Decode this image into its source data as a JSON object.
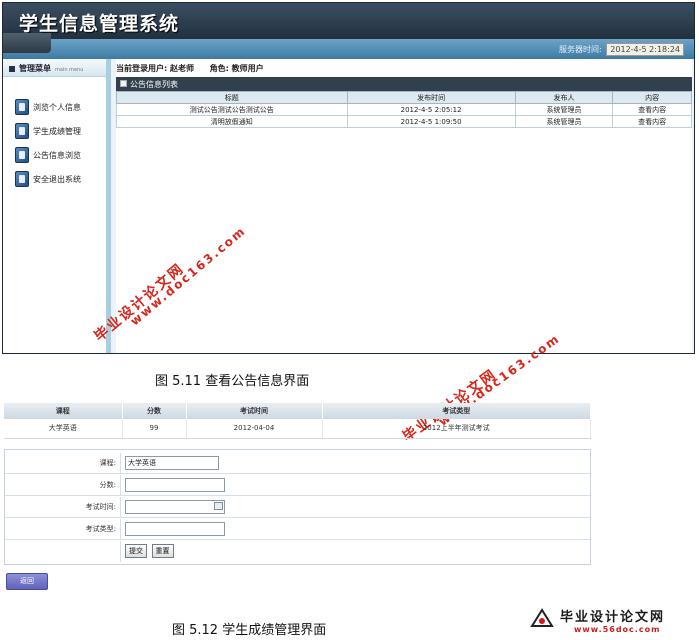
{
  "app": {
    "title": "学生信息管理系统",
    "server_time_label": "服务器时间:",
    "server_time_value": "2012-4-5 2:18:24"
  },
  "sidebar": {
    "header": "管理菜单",
    "header_sub": "main menu",
    "items": [
      {
        "label": "浏览个人信息",
        "icon": "document-icon"
      },
      {
        "label": "学生成绩管理",
        "icon": "document-icon"
      },
      {
        "label": "公告信息浏览",
        "icon": "document-icon"
      },
      {
        "label": "安全退出系统",
        "icon": "document-icon"
      }
    ]
  },
  "userbar": {
    "user_label": "当前登录用户:",
    "user_name": "赵老师",
    "role_label": "角色:",
    "role_name": "教师用户"
  },
  "notice_panel": {
    "title": "公告信息列表",
    "columns": [
      "标题",
      "发布时间",
      "发布人",
      "内容"
    ],
    "rows": [
      [
        "测试公告测试公告测试公告",
        "2012-4-5 2:05:12",
        "系统管理员",
        "查看内容"
      ],
      [
        "清明放假通知",
        "2012-4-5 1:09:50",
        "系统管理员",
        "查看内容"
      ]
    ]
  },
  "watermarks": {
    "site": "www.doc163.com",
    "name": "毕业设计论文网"
  },
  "captions": {
    "fig1": "图 5.11 查看公告信息界面",
    "fig2": "图 5.12 学生成绩管理界面"
  },
  "grades_table": {
    "columns": [
      "课程",
      "分数",
      "考试时间",
      "考试类型"
    ],
    "rows": [
      [
        "大学英语",
        "99",
        "2012-04-04",
        "2012上半年测试考试"
      ]
    ]
  },
  "grade_form": {
    "course_label": "课程:",
    "course_value": "大学英语",
    "score_label": "分数:",
    "score_value": "",
    "time_label": "考试时间:",
    "time_value": "",
    "type_label": "考试类型:",
    "type_value": "",
    "submit_label": "提交",
    "reset_label": "重置"
  },
  "back_button": "返回",
  "footer_logo": {
    "brand": "毕业设计论文网",
    "url": "www.56doc.com"
  }
}
